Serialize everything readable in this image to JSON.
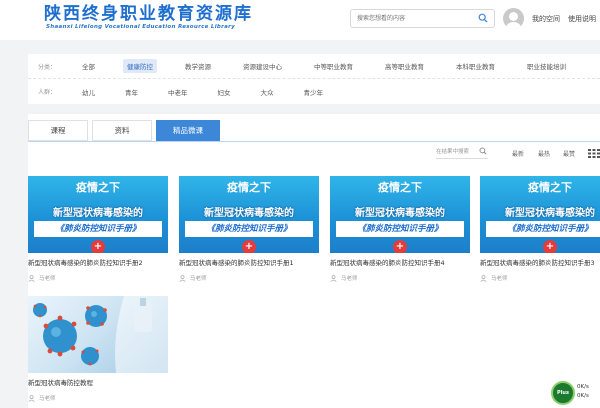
{
  "header": {
    "logo_cn": "陕西终身职业教育资源库",
    "logo_en": "Shaanxi Lifelong Vocational Education Resource Library",
    "search_placeholder": "搜索您想看的内容",
    "link_my_study": "我的空间",
    "link_help": "使用说明"
  },
  "filters": {
    "category_label": "分类：",
    "categories": [
      {
        "label": "全部",
        "active": false
      },
      {
        "label": "健康防控",
        "active": true
      },
      {
        "label": "教学资源"
      },
      {
        "label": "资源建设中心"
      },
      {
        "label": "中等职业教育"
      },
      {
        "label": "高等职业教育"
      },
      {
        "label": "本科职业教育"
      },
      {
        "label": "职业技能培训"
      }
    ],
    "audience_label": "人群：",
    "audiences": [
      "幼儿",
      "青年",
      "中老年",
      "妇女",
      "大众",
      "青少年"
    ]
  },
  "tabs": [
    {
      "label": "课程",
      "active": false
    },
    {
      "label": "资料",
      "active": false
    },
    {
      "label": "精品微课",
      "active": true
    }
  ],
  "sortbar": {
    "search_placeholder": "在结果中搜索",
    "sort_newest": "最新",
    "sort_hot": "最热",
    "sort_rating": "最赞"
  },
  "thumb": {
    "headline": "疫情之下",
    "line1": "新型冠状病毒感染的",
    "line2": "《肺炎防控知识手册》"
  },
  "cards": [
    {
      "title": "新型冠状病毒感染的肺炎防控知识手册2",
      "author": "马老师"
    },
    {
      "title": "新型冠状病毒感染的肺炎防控知识手册1",
      "author": "马老师"
    },
    {
      "title": "新型冠状病毒感染的肺炎防控知识手册4",
      "author": "马老师"
    },
    {
      "title": "新型冠状病毒感染的肺炎防控知识手册3",
      "author": "马老师"
    },
    {
      "title": "新型冠状病毒防控教程",
      "author": "马老师"
    }
  ],
  "corner": {
    "badge": "Plus",
    "line1": "0K/s",
    "line2": "0K/s"
  },
  "colors": {
    "primary": "#3d87d8",
    "logo": "#1f6fcf",
    "thumb_blue": "#1c8fd6",
    "plus_red": "#e53b3b"
  }
}
